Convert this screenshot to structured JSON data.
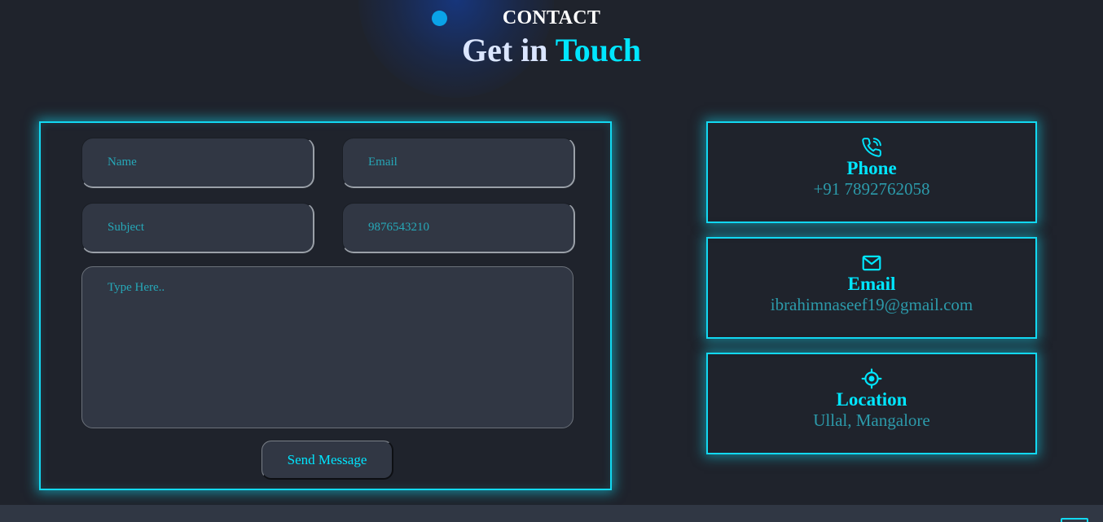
{
  "header": {
    "eyebrow": "CONTACT",
    "title_part1": "Get in",
    "title_part2": "Touch"
  },
  "form": {
    "name_placeholder": "Name",
    "email_placeholder": "Email",
    "subject_placeholder": "Subject",
    "phone_placeholder": "9876543210",
    "message_placeholder": "Type Here..",
    "send_label": "Send Message"
  },
  "contact_cards": [
    {
      "icon": "phone-icon",
      "label": "Phone",
      "value": "+91 7892762058"
    },
    {
      "icon": "mail-icon",
      "label": "Email",
      "value": "ibrahimnaseef19@gmail.com"
    },
    {
      "icon": "location-target-icon",
      "label": "Location",
      "value": "Ullal, Mangalore"
    }
  ],
  "colors": {
    "accent": "#00e6ff",
    "background": "#1f232c",
    "field_bg": "#313744",
    "muted_text": "#2c9aaa"
  }
}
